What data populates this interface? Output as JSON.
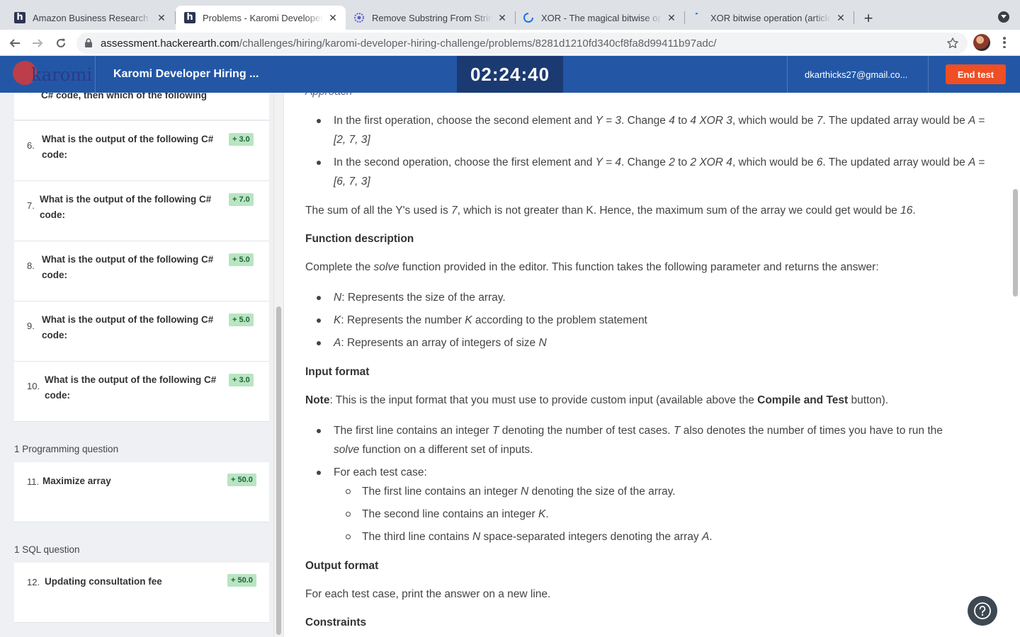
{
  "browser": {
    "tabs": [
      {
        "title": "Amazon Business Research An",
        "icon": "hackerearth-favicon"
      },
      {
        "title": "Problems - Karomi Developer H",
        "icon": "hackerearth-favicon"
      },
      {
        "title": "Remove Substring From String",
        "icon": "gear-favicon"
      },
      {
        "title": "XOR - The magical bitwise ope",
        "icon": "loading-spinner"
      },
      {
        "title": "XOR bitwise operation (article)",
        "icon": "loading-spinner"
      }
    ],
    "url_host": "assessment.hackerearth.com",
    "url_path": "/challenges/hiring/karomi-developer-hiring-challenge/problems/8281d1210fd340cf8fa8d99411b97adc/"
  },
  "header": {
    "logo_text": "karomi",
    "contest_title": "Karomi Developer Hiring ...",
    "timer": "02:24:40",
    "email": "dkarthicks27@gmail.co...",
    "end_test_label": "End test"
  },
  "sidebar": {
    "partial_question_text": "C# code, then which of the following",
    "mcq_questions": [
      {
        "num": "6.",
        "text": "What is the output of the following C# code:",
        "score": "+ 3.0"
      },
      {
        "num": "7.",
        "text": "What is the output of the following C# code:",
        "score": "+ 7.0"
      },
      {
        "num": "8.",
        "text": "What is the output of the following C# code:",
        "score": "+ 5.0"
      },
      {
        "num": "9.",
        "text": "What is the output of the following C# code:",
        "score": "+ 5.0"
      },
      {
        "num": "10.",
        "text": "What is the output of the following C# code:",
        "score": "+ 3.0"
      }
    ],
    "programming_section_label": "1 Programming question",
    "programming_question": {
      "num": "11.",
      "text": "Maximize array",
      "score": "+ 50.0"
    },
    "sql_section_label": "1 SQL question",
    "sql_question": {
      "num": "12.",
      "text": "Updating consultation fee",
      "score": "+ 50.0"
    }
  },
  "problem": {
    "approach_heading": "Approach",
    "approach_items": [
      "In the first operation, choose the second element and Y = 3. Change 4 to 4 XOR 3, which would be 7. The updated array would be A = [2, 7, 3]",
      "In the second operation, choose the first element and Y = 4. Change 2 to 2 XOR 4, which would be 6. The updated array would be A = [6, 7, 3]"
    ],
    "sum_sentence": "The sum of all the Y's used is 7, which is not greater than K. Hence, the maximum sum of the array we could get would be 16.",
    "function_heading": "Function description",
    "function_text_pre": "Complete the ",
    "function_name": "solve",
    "function_text_post": " function provided in the editor. This function takes the following parameter and returns the answer:",
    "params": [
      {
        "name": "N",
        "desc": ": Represents the size of the array."
      },
      {
        "name": "K",
        "desc": ": Represents the number K according to the problem statement"
      },
      {
        "name": "A",
        "desc": ": Represents an array of integers of size N"
      }
    ],
    "input_heading": "Input format",
    "note_label": "Note",
    "note_text": ": This is the input format that you must use to provide custom input (available above the ",
    "note_bold": "Compile and Test",
    "note_end": " button).",
    "input_line1": "The first line contains an integer T denoting the number of test cases. T also denotes the number of times you have to run the solve function on a different set of inputs.",
    "input_line2": "For each test case:",
    "sub_items": [
      "The first line contains an integer N denoting the size of the array.",
      "The second line contains an integer K.",
      "The third line contains N space-separated integers denoting the array A."
    ],
    "output_heading": "Output format",
    "output_text": "For each test case, print the answer on a new line.",
    "constraints_heading": "Constraints"
  },
  "help_icon": "question-mark-icon"
}
